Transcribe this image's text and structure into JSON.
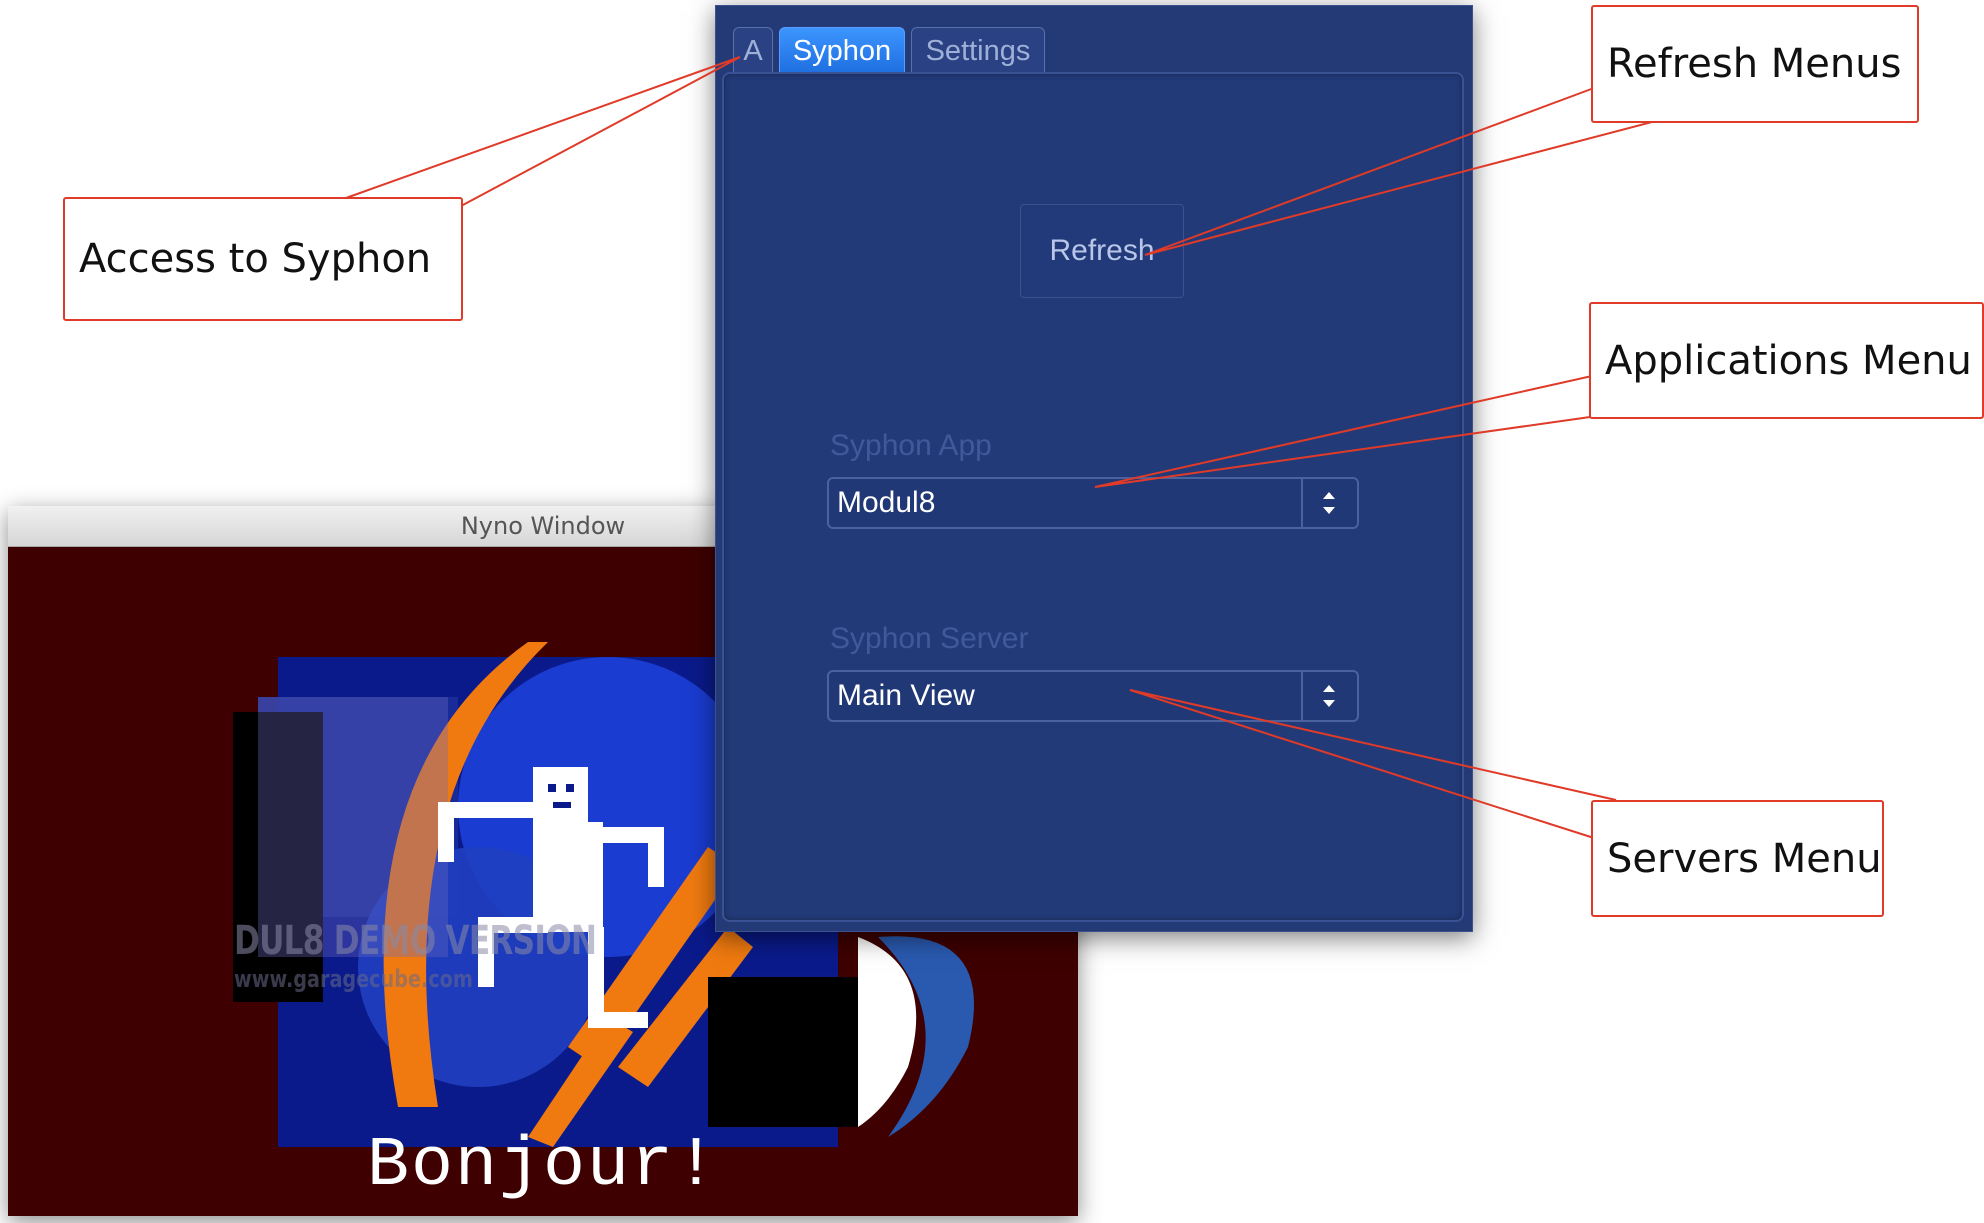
{
  "nyno_window": {
    "title": "Nyno Window",
    "watermark": "DUL8 DEMO VERSION",
    "watermark_url": "www.garagecube.com",
    "greeting": "Bonjour!"
  },
  "panel": {
    "tabs": [
      {
        "label": "A",
        "active": false
      },
      {
        "label": "Syphon",
        "active": true
      },
      {
        "label": "Settings",
        "active": false
      }
    ],
    "refresh_label": "Refresh",
    "syphon_app": {
      "label": "Syphon App",
      "value": "Modul8"
    },
    "syphon_server": {
      "label": "Syphon Server",
      "value": "Main View"
    }
  },
  "callouts": {
    "access_syphon": "Access to Syphon",
    "refresh_menus": "Refresh Menus",
    "applications_menu": "Applications Menu",
    "servers_menu": "Servers Menu"
  },
  "colors": {
    "panel_bg": "#233a77",
    "active_tab": "#2f86f5",
    "callout_border": "#e03a28",
    "nyno_bg": "#3e0000"
  }
}
